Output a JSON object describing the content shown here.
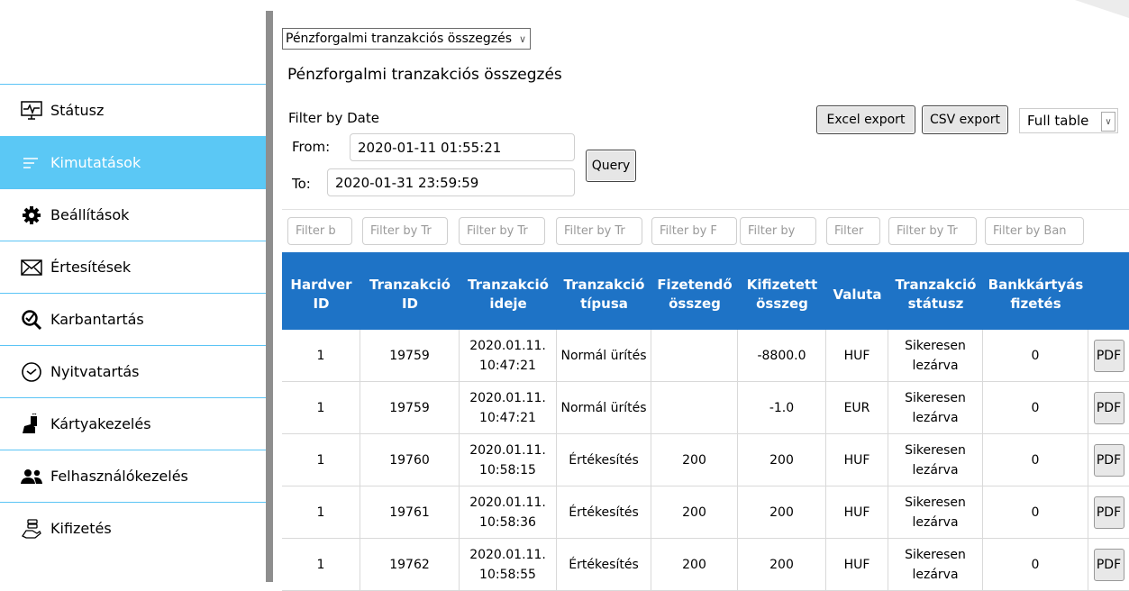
{
  "sidebar": {
    "items": [
      {
        "label": "Státusz",
        "icon": "monitor-pulse-icon",
        "active": false
      },
      {
        "label": "Kimutatások",
        "icon": "list-lines-icon",
        "active": true
      },
      {
        "label": "Beállítások",
        "icon": "gear-icon",
        "active": false
      },
      {
        "label": "Értesítések",
        "icon": "envelope-icon",
        "active": false
      },
      {
        "label": "Karbantartás",
        "icon": "magnifier-check-icon",
        "active": false
      },
      {
        "label": "Nyitvatartás",
        "icon": "clock-icon",
        "active": false
      },
      {
        "label": "Kártyakezelés",
        "icon": "hand-card-icon",
        "active": false
      },
      {
        "label": "Felhasználókezelés",
        "icon": "users-icon",
        "active": false
      },
      {
        "label": "Kifizetés",
        "icon": "hand-coins-icon",
        "active": false
      }
    ]
  },
  "header": {
    "report_select": "Pénzforgalmi tranzakciós összegzés",
    "page_title": "Pénzforgalmi tranzakciós összegzés"
  },
  "filter": {
    "label": "Filter by Date",
    "from_label": "From:",
    "from_value": "2020-01-11 01:55:21",
    "to_label": "To:",
    "to_value": "2020-01-31 23:59:59",
    "query_label": "Query"
  },
  "toolbar": {
    "excel_label": "Excel export",
    "csv_label": "CSV export",
    "view_select": "Full table"
  },
  "column_filters": [
    "Filter b",
    "Filter by Tr",
    "Filter by Tr",
    "Filter by Tr",
    "Filter by F",
    "Filter by",
    "Filter",
    "Filter by Tr",
    "Filter by Ban"
  ],
  "table": {
    "headers": [
      "Hardver ID",
      "Tranzakció ID",
      "Tranzakció ideje",
      "Tranzakció típusa",
      "Fizetendő összeg",
      "Kifizetett összeg",
      "Valuta",
      "Tranzakció státusz",
      "Bankkártyás fizetés",
      ""
    ],
    "pdf_label": "PDF",
    "rows": [
      [
        "1",
        "19759",
        "2020.01.11. 10:47:21",
        "Normál ürítés",
        "",
        "-8800.0",
        "HUF",
        "Sikeresen lezárva",
        "0"
      ],
      [
        "1",
        "19759",
        "2020.01.11. 10:47:21",
        "Normál ürítés",
        "",
        "-1.0",
        "EUR",
        "Sikeresen lezárva",
        "0"
      ],
      [
        "1",
        "19760",
        "2020.01.11. 10:58:15",
        "Értékesítés",
        "200",
        "200",
        "HUF",
        "Sikeresen lezárva",
        "0"
      ],
      [
        "1",
        "19761",
        "2020.01.11. 10:58:36",
        "Értékesítés",
        "200",
        "200",
        "HUF",
        "Sikeresen lezárva",
        "0"
      ],
      [
        "1",
        "19762",
        "2020.01.11. 10:58:55",
        "Értékesítés",
        "200",
        "200",
        "HUF",
        "Sikeresen lezárva",
        "0"
      ]
    ]
  },
  "colors": {
    "accent": "#5bc8f5",
    "header_bg": "#1e73c6",
    "divider": "#8e8e8e"
  }
}
